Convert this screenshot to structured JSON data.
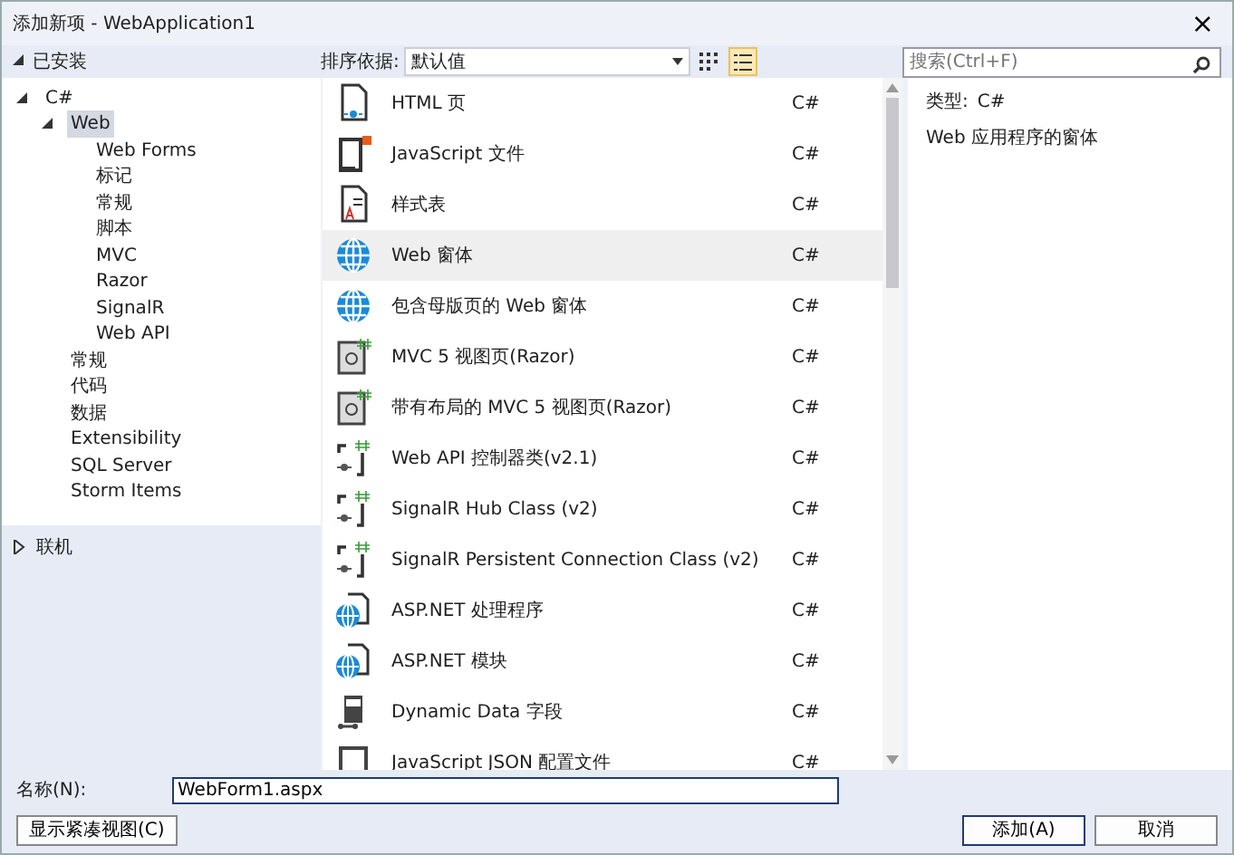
{
  "window": {
    "title": "添加新项 - WebApplication1",
    "close": "×"
  },
  "installed": {
    "label": "已安装",
    "expanded": true
  },
  "sort": {
    "label": "排序依据:",
    "value": "默认值"
  },
  "view_modes": [
    {
      "kind": "grid",
      "selected": false
    },
    {
      "kind": "list",
      "selected": true
    }
  ],
  "search": {
    "placeholder": "搜索(Ctrl+F)"
  },
  "tree": [
    {
      "label": "C#",
      "expanded": true,
      "selected": false,
      "children": [
        {
          "label": "Web",
          "expanded": true,
          "selected": true,
          "children": [
            {
              "label": "Web Forms",
              "selected": false
            },
            {
              "label": "标记",
              "selected": false
            },
            {
              "label": "常规",
              "selected": false
            },
            {
              "label": "脚本",
              "selected": false
            },
            {
              "label": "MVC",
              "selected": false
            },
            {
              "label": "Razor",
              "selected": false
            },
            {
              "label": "SignalR",
              "selected": false
            },
            {
              "label": "Web API",
              "selected": false
            }
          ]
        },
        {
          "label": "常规",
          "selected": false
        },
        {
          "label": "代码",
          "selected": false
        },
        {
          "label": "数据",
          "selected": false
        },
        {
          "label": "Extensibility",
          "selected": false
        },
        {
          "label": "SQL Server",
          "selected": false
        },
        {
          "label": "Storm Items",
          "selected": false
        }
      ]
    }
  ],
  "online": {
    "label": "联机",
    "expanded": false
  },
  "templates": [
    {
      "kind": "html",
      "name": "HTML 页",
      "language": "C#",
      "selected": false
    },
    {
      "kind": "js",
      "name": "JavaScript 文件",
      "language": "C#",
      "selected": false
    },
    {
      "kind": "css",
      "name": "样式表",
      "language": "C#",
      "selected": false
    },
    {
      "kind": "globe",
      "name": "Web 窗体",
      "language": "C#",
      "selected": true
    },
    {
      "kind": "globe",
      "name": "包含母版页的 Web 窗体",
      "language": "C#",
      "selected": false
    },
    {
      "kind": "razor",
      "name": "MVC 5 视图页(Razor)",
      "language": "C#",
      "selected": false
    },
    {
      "kind": "razor",
      "name": "带有布局的 MVC 5 视图页(Razor)",
      "language": "C#",
      "selected": false
    },
    {
      "kind": "class",
      "name": "Web API 控制器类(v2.1)",
      "language": "C#",
      "selected": false
    },
    {
      "kind": "class",
      "name": "SignalR Hub Class (v2)",
      "language": "C#",
      "selected": false
    },
    {
      "kind": "class",
      "name": "SignalR Persistent Connection Class (v2)",
      "language": "C#",
      "selected": false
    },
    {
      "kind": "webdoc",
      "name": "ASP.NET 处理程序",
      "language": "C#",
      "selected": false
    },
    {
      "kind": "webdoc",
      "name": "ASP.NET 模块",
      "language": "C#",
      "selected": false
    },
    {
      "kind": "dynamic",
      "name": "Dynamic Data 字段",
      "language": "C#",
      "selected": false
    },
    {
      "kind": "json",
      "name": "JavaScript JSON 配置文件",
      "language": "C#",
      "selected": false
    }
  ],
  "details": {
    "type_label": "类型:",
    "type_value": "C#",
    "description": "Web 应用程序的窗体"
  },
  "name_field": {
    "label": "名称(N):",
    "value": "WebForm1.aspx"
  },
  "buttons": [
    {
      "kind": "compact",
      "label": "显示紧凑视图(C)"
    },
    {
      "kind": "add",
      "label": "添加(A)"
    },
    {
      "kind": "cancel",
      "label": "取消"
    }
  ]
}
